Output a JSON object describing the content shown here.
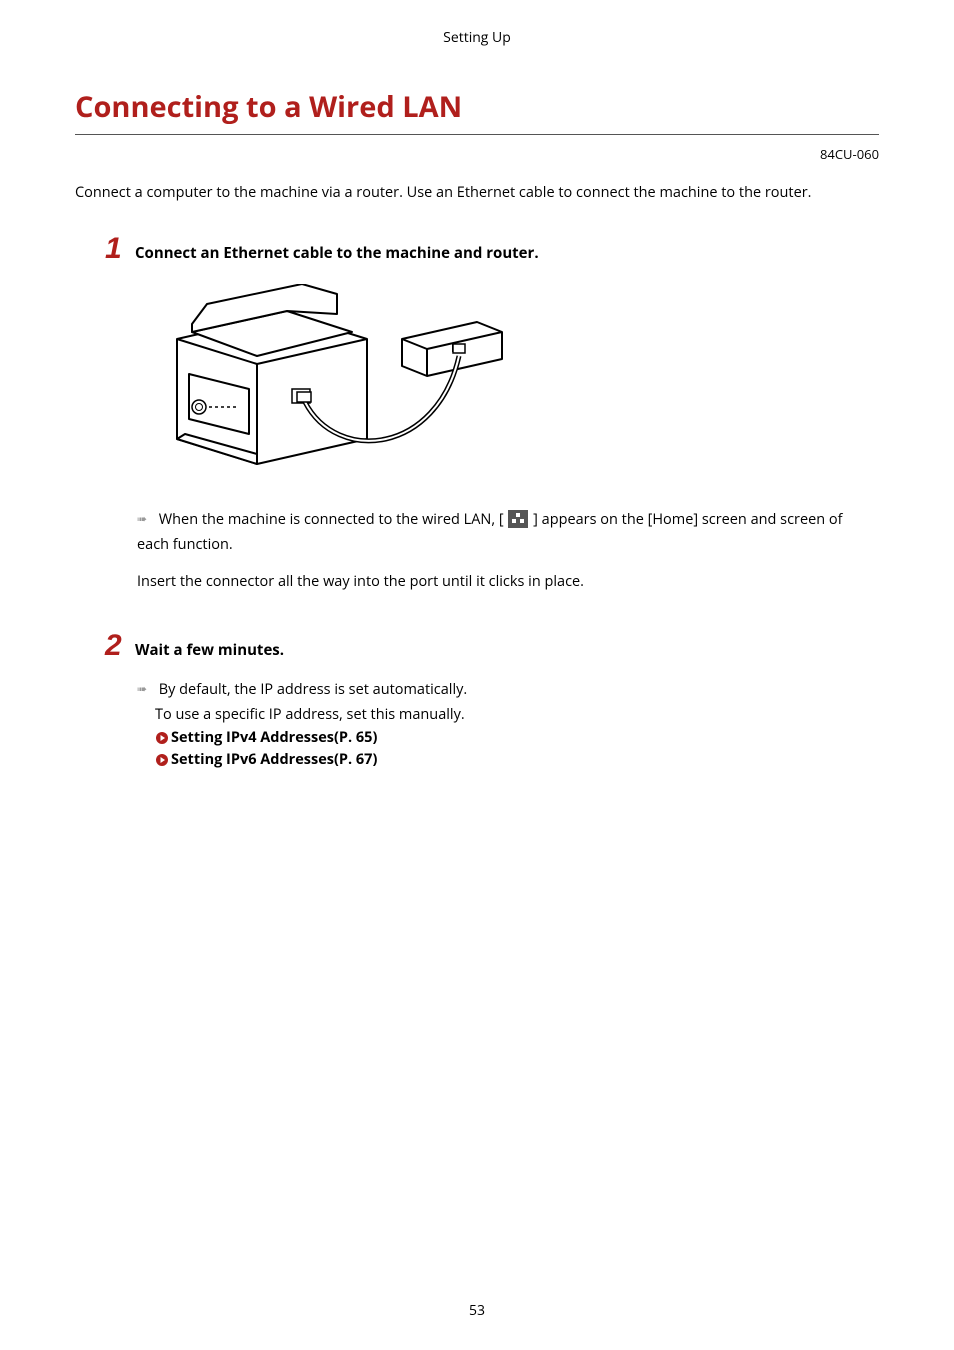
{
  "header": {
    "section": "Setting Up"
  },
  "title": "Connecting to a Wired LAN",
  "doc_code": "84CU-060",
  "intro": "Connect a computer to the machine via a router. Use an Ethernet cable to connect the machine to the router.",
  "steps": {
    "s1": {
      "num": "1",
      "title": "Connect an Ethernet cable to the machine and router.",
      "result_pre": "When the machine is connected to the wired LAN, [",
      "result_post": "] appears on the [Home] screen and screen of each function.",
      "note": "Insert the connector all the way into the port until it clicks in place."
    },
    "s2": {
      "num": "2",
      "title": "Wait a few minutes.",
      "result_line1": "By default, the IP address is set automatically.",
      "result_line2": "To use a specific IP address, set this manually.",
      "links": {
        "ipv4": "Setting IPv4 Addresses(P. 65)",
        "ipv6": "Setting IPv6 Addresses(P. 67)"
      }
    }
  },
  "page_number": "53"
}
